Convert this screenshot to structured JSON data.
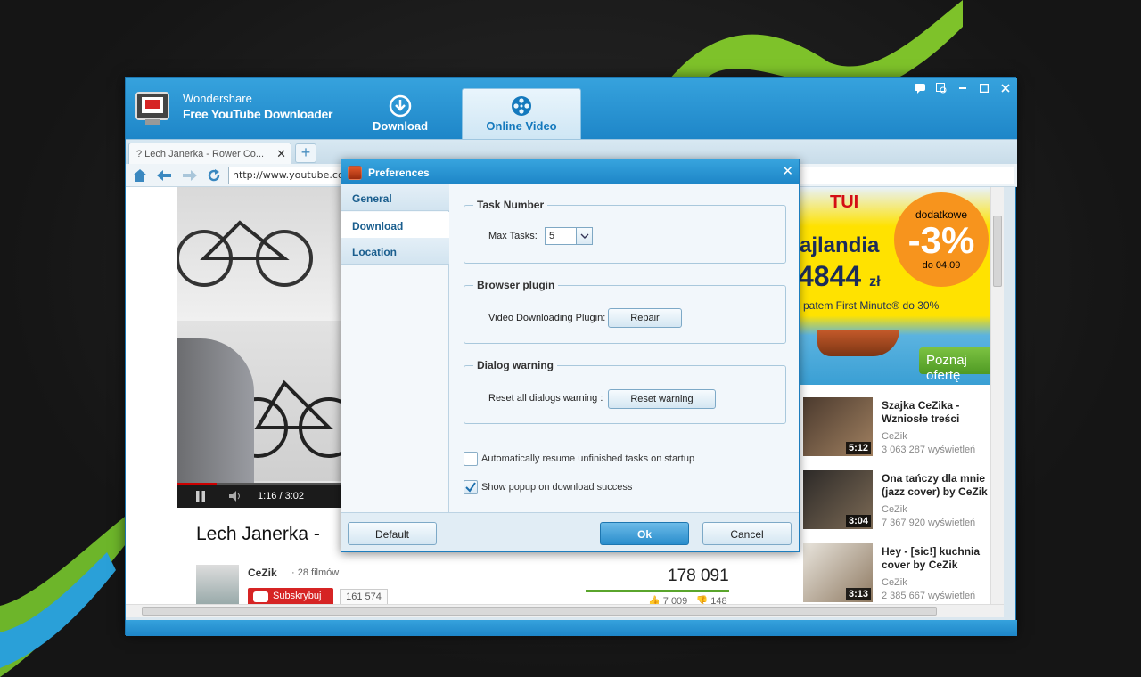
{
  "app": {
    "brand_line1": "Wondershare",
    "brand_line2": "Free YouTube Downloader",
    "tabs": [
      {
        "label": "Download",
        "icon": "download-circle-icon"
      },
      {
        "label": "Online Video",
        "icon": "film-reel-icon"
      }
    ],
    "active_tab": "Online Video",
    "window_controls": [
      "feedback-icon",
      "register-icon",
      "minimize-icon",
      "maximize-icon",
      "close-icon"
    ]
  },
  "browser": {
    "tab_title": "? Lech Janerka - Rower Co...",
    "new_tab_label": "+",
    "url": "http://www.youtube.com/"
  },
  "page": {
    "video_time": "1:16 / 3:02",
    "video_progress": 0.24,
    "video_title": "Lech Janerka -",
    "channel_name": "CeZik",
    "channel_videos": "· 28 filmów",
    "subscribe_label": "Subskrybuj",
    "subscriber_count": "161 574",
    "view_count": "178 091",
    "likes": "7 009",
    "dislikes": "148",
    "ad": {
      "brand": "TUI",
      "badge_top": "dodatkowe",
      "badge_value": "-3%",
      "badge_bottom": "do 04.09",
      "country": "ajlandia",
      "price": "4844",
      "currency": "zł",
      "subtext": "patem First Minute® do 30%",
      "cta": "Poznaj ofertę"
    },
    "related": [
      {
        "title": "Szajka CeZika - Wzniosłe treści",
        "channel": "CeZik",
        "views": "3 063 287 wyświetleń",
        "duration": "5:12"
      },
      {
        "title": "Ona tańczy dla mnie (jazz cover) by CeZik",
        "channel": "CeZik",
        "views": "7 367 920 wyświetleń",
        "duration": "3:04"
      },
      {
        "title": "Hey - [sic!] kuchnia cover by CeZik",
        "channel": "CeZik",
        "views": "2 385 667 wyświetleń",
        "duration": "3:13"
      }
    ]
  },
  "dialog": {
    "title": "Preferences",
    "sidebar": [
      {
        "label": "General",
        "selected": true
      },
      {
        "label": "Download",
        "selected": false
      },
      {
        "label": "Location",
        "selected": false
      }
    ],
    "task_number": {
      "title": "Task Number",
      "max_tasks_label": "Max Tasks:",
      "max_tasks_value": "5"
    },
    "browser_plugin": {
      "title": "Browser plugin",
      "label": "Video Downloading Plugin:",
      "button": "Repair"
    },
    "dialog_warning": {
      "title": "Dialog warning",
      "label": "Reset all dialogs warning :",
      "button": "Reset warning"
    },
    "options": [
      {
        "label": "Automatically resume unfinished  tasks on startup",
        "checked": false
      },
      {
        "label": "Show popup on download success",
        "checked": true
      }
    ],
    "footer": {
      "default": "Default",
      "ok": "Ok",
      "cancel": "Cancel"
    }
  },
  "colors": {
    "accent": "#1e86c8",
    "accent_light": "#36a2dd",
    "youtube_red": "#d62424"
  }
}
